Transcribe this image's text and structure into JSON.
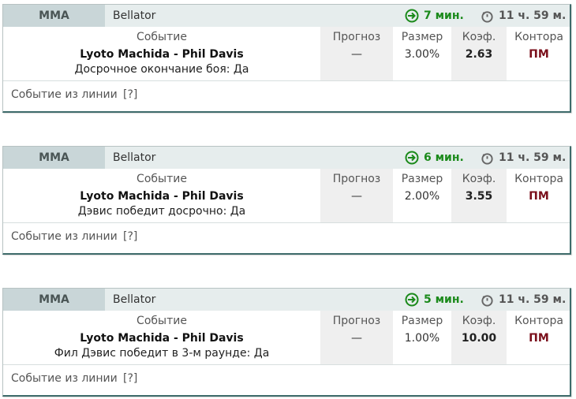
{
  "columns": {
    "event": "Событие",
    "forecast": "Прогноз",
    "size": "Размер",
    "odds": "Коэф.",
    "bookmaker": "Контора"
  },
  "footer": {
    "label": "Событие из линии",
    "help": "[?]"
  },
  "colors": {
    "posted_time": "#1b8a1b",
    "bookmaker": "#7a0f1b",
    "sport_bg": "#c9d6d8",
    "header_bg": "#e6eded",
    "border": "#3d6b6a"
  },
  "cards": [
    {
      "sport": "MMA",
      "league": "Bellator",
      "posted_ago": "7 мин.",
      "time_to_start": "11 ч. 59 м.",
      "event_title": "Lyoto Machida - Phil Davis",
      "outcome": "Досрочное окончание боя: Да",
      "forecast": "—",
      "size": "3.00%",
      "odds": "2.63",
      "bookmaker": "ПМ"
    },
    {
      "sport": "MMA",
      "league": "Bellator",
      "posted_ago": "6 мин.",
      "time_to_start": "11 ч. 59 м.",
      "event_title": "Lyoto Machida - Phil Davis",
      "outcome": "Дэвис победит досрочно: Да",
      "forecast": "—",
      "size": "2.00%",
      "odds": "3.55",
      "bookmaker": "ПМ"
    },
    {
      "sport": "MMA",
      "league": "Bellator",
      "posted_ago": "5 мин.",
      "time_to_start": "11 ч. 59 м.",
      "event_title": "Lyoto Machida - Phil Davis",
      "outcome": "Фил Дэвис победит в 3-м раунде: Да",
      "forecast": "—",
      "size": "1.00%",
      "odds": "10.00",
      "bookmaker": "ПМ"
    }
  ]
}
